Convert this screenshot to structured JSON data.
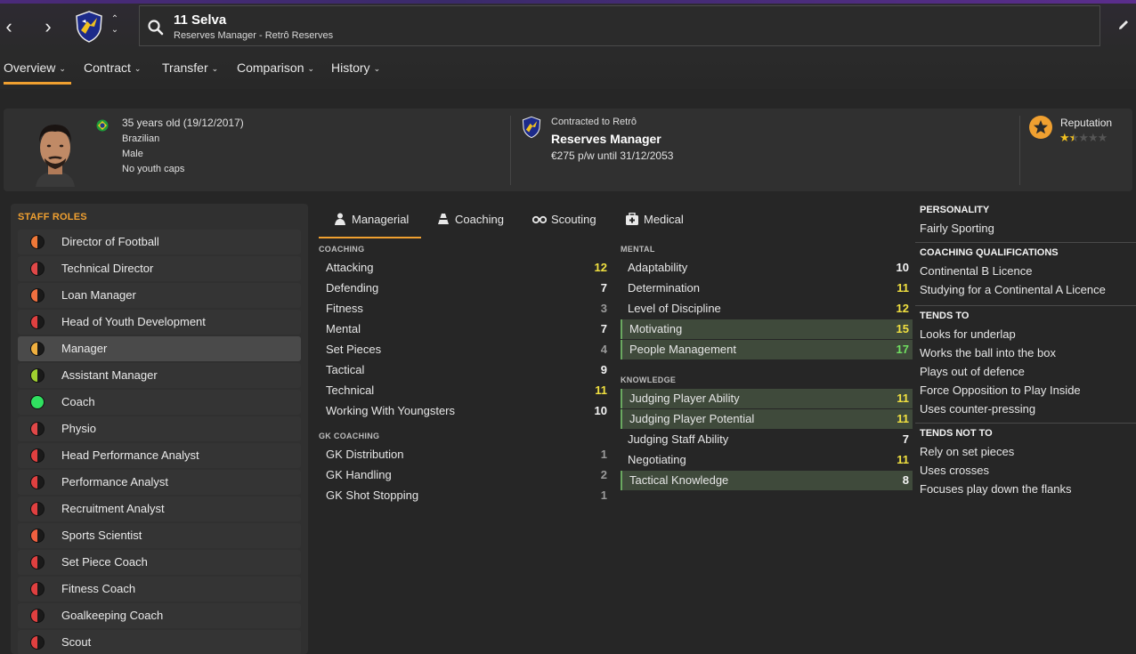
{
  "header": {
    "name": "11 Selva",
    "subtitle": "Reserves Manager - Retrô Reserves"
  },
  "tabs": [
    {
      "label": "Overview"
    },
    {
      "label": "Contract"
    },
    {
      "label": "Transfer"
    },
    {
      "label": "Comparison"
    },
    {
      "label": "History"
    }
  ],
  "profile": {
    "age": "35 years old (19/12/2017)",
    "nationality": "Brazilian",
    "gender": "Male",
    "youth_caps": "No youth caps"
  },
  "contract": {
    "label": "Contracted to Retrô",
    "role": "Reserves Manager",
    "wage": "€275 p/w until 31/12/2053"
  },
  "reputation": {
    "label": "Reputation",
    "stars": 1.5,
    "max_stars": 5
  },
  "staff_roles": {
    "title": "STAFF ROLES",
    "items": [
      {
        "label": "Director of Football",
        "color": "#f07838",
        "fill": 0.5
      },
      {
        "label": "Technical Director",
        "color": "#e04848",
        "fill": 0.5
      },
      {
        "label": "Loan Manager",
        "color": "#f07040",
        "fill": 0.5
      },
      {
        "label": "Head of Youth Development",
        "color": "#e04040",
        "fill": 0.5
      },
      {
        "label": "Manager",
        "color": "#f0b040",
        "fill": 0.5
      },
      {
        "label": "Assistant Manager",
        "color": "#a0d030",
        "fill": 0.5
      },
      {
        "label": "Coach",
        "color": "#30e060",
        "fill": 1.0
      },
      {
        "label": "Physio",
        "color": "#e04848",
        "fill": 0.5
      },
      {
        "label": "Head Performance Analyst",
        "color": "#e04040",
        "fill": 0.5
      },
      {
        "label": "Performance Analyst",
        "color": "#e04040",
        "fill": 0.5
      },
      {
        "label": "Recruitment Analyst",
        "color": "#e04040",
        "fill": 0.5
      },
      {
        "label": "Sports Scientist",
        "color": "#f06040",
        "fill": 0.5
      },
      {
        "label": "Set Piece Coach",
        "color": "#e04040",
        "fill": 0.5
      },
      {
        "label": "Fitness Coach",
        "color": "#e04040",
        "fill": 0.5
      },
      {
        "label": "Goalkeeping Coach",
        "color": "#e04040",
        "fill": 0.5
      },
      {
        "label": "Scout",
        "color": "#e04040",
        "fill": 0.5
      }
    ]
  },
  "attr_tabs": [
    {
      "label": "Managerial",
      "icon": "managerial-icon"
    },
    {
      "label": "Coaching",
      "icon": "coaching-cone-icon"
    },
    {
      "label": "Scouting",
      "icon": "binoculars-icon"
    },
    {
      "label": "Medical",
      "icon": "medical-kit-icon"
    }
  ],
  "coaching": {
    "title": "COACHING",
    "items": [
      {
        "name": "Attacking",
        "value": "12",
        "tone": "yellow"
      },
      {
        "name": "Defending",
        "value": "7",
        "tone": "white"
      },
      {
        "name": "Fitness",
        "value": "3",
        "tone": "grey"
      },
      {
        "name": "Mental",
        "value": "7",
        "tone": "white"
      },
      {
        "name": "Set Pieces",
        "value": "4",
        "tone": "grey"
      },
      {
        "name": "Tactical",
        "value": "9",
        "tone": "white"
      },
      {
        "name": "Technical",
        "value": "11",
        "tone": "yellow"
      },
      {
        "name": "Working With Youngsters",
        "value": "10",
        "tone": "white"
      }
    ]
  },
  "gk_coaching": {
    "title": "GK COACHING",
    "items": [
      {
        "name": "GK Distribution",
        "value": "1",
        "tone": "grey"
      },
      {
        "name": "GK Handling",
        "value": "2",
        "tone": "grey"
      },
      {
        "name": "GK Shot Stopping",
        "value": "1",
        "tone": "grey"
      }
    ]
  },
  "mental": {
    "title": "MENTAL",
    "items": [
      {
        "name": "Adaptability",
        "value": "10",
        "tone": "white",
        "hl": false
      },
      {
        "name": "Determination",
        "value": "11",
        "tone": "yellow",
        "hl": false
      },
      {
        "name": "Level of Discipline",
        "value": "12",
        "tone": "yellow",
        "hl": false
      },
      {
        "name": "Motivating",
        "value": "15",
        "tone": "yellow",
        "hl": true
      },
      {
        "name": "People Management",
        "value": "17",
        "tone": "green",
        "hl": true
      }
    ]
  },
  "knowledge": {
    "title": "KNOWLEDGE",
    "items": [
      {
        "name": "Judging Player Ability",
        "value": "11",
        "tone": "yellow",
        "hl": true
      },
      {
        "name": "Judging Player Potential",
        "value": "11",
        "tone": "yellow",
        "hl": true
      },
      {
        "name": "Judging Staff Ability",
        "value": "7",
        "tone": "white",
        "hl": false
      },
      {
        "name": "Negotiating",
        "value": "11",
        "tone": "yellow",
        "hl": false
      },
      {
        "name": "Tactical Knowledge",
        "value": "8",
        "tone": "white",
        "hl": true
      }
    ]
  },
  "personality": {
    "title": "PERSONALITY",
    "value": "Fairly Sporting"
  },
  "qualifications": {
    "title": "COACHING QUALIFICATIONS",
    "items": [
      "Continental B Licence",
      "Studying for a Continental A Licence"
    ]
  },
  "tends_to": {
    "title": "TENDS TO",
    "items": [
      "Looks for underlap",
      "Works the ball into the box",
      "Plays out of defence",
      "Force Opposition to Play Inside",
      "Uses counter-pressing"
    ]
  },
  "tends_not_to": {
    "title": "TENDS NOT TO",
    "items": [
      "Rely on set pieces",
      "Uses crosses",
      "Focuses play down the flanks"
    ]
  }
}
